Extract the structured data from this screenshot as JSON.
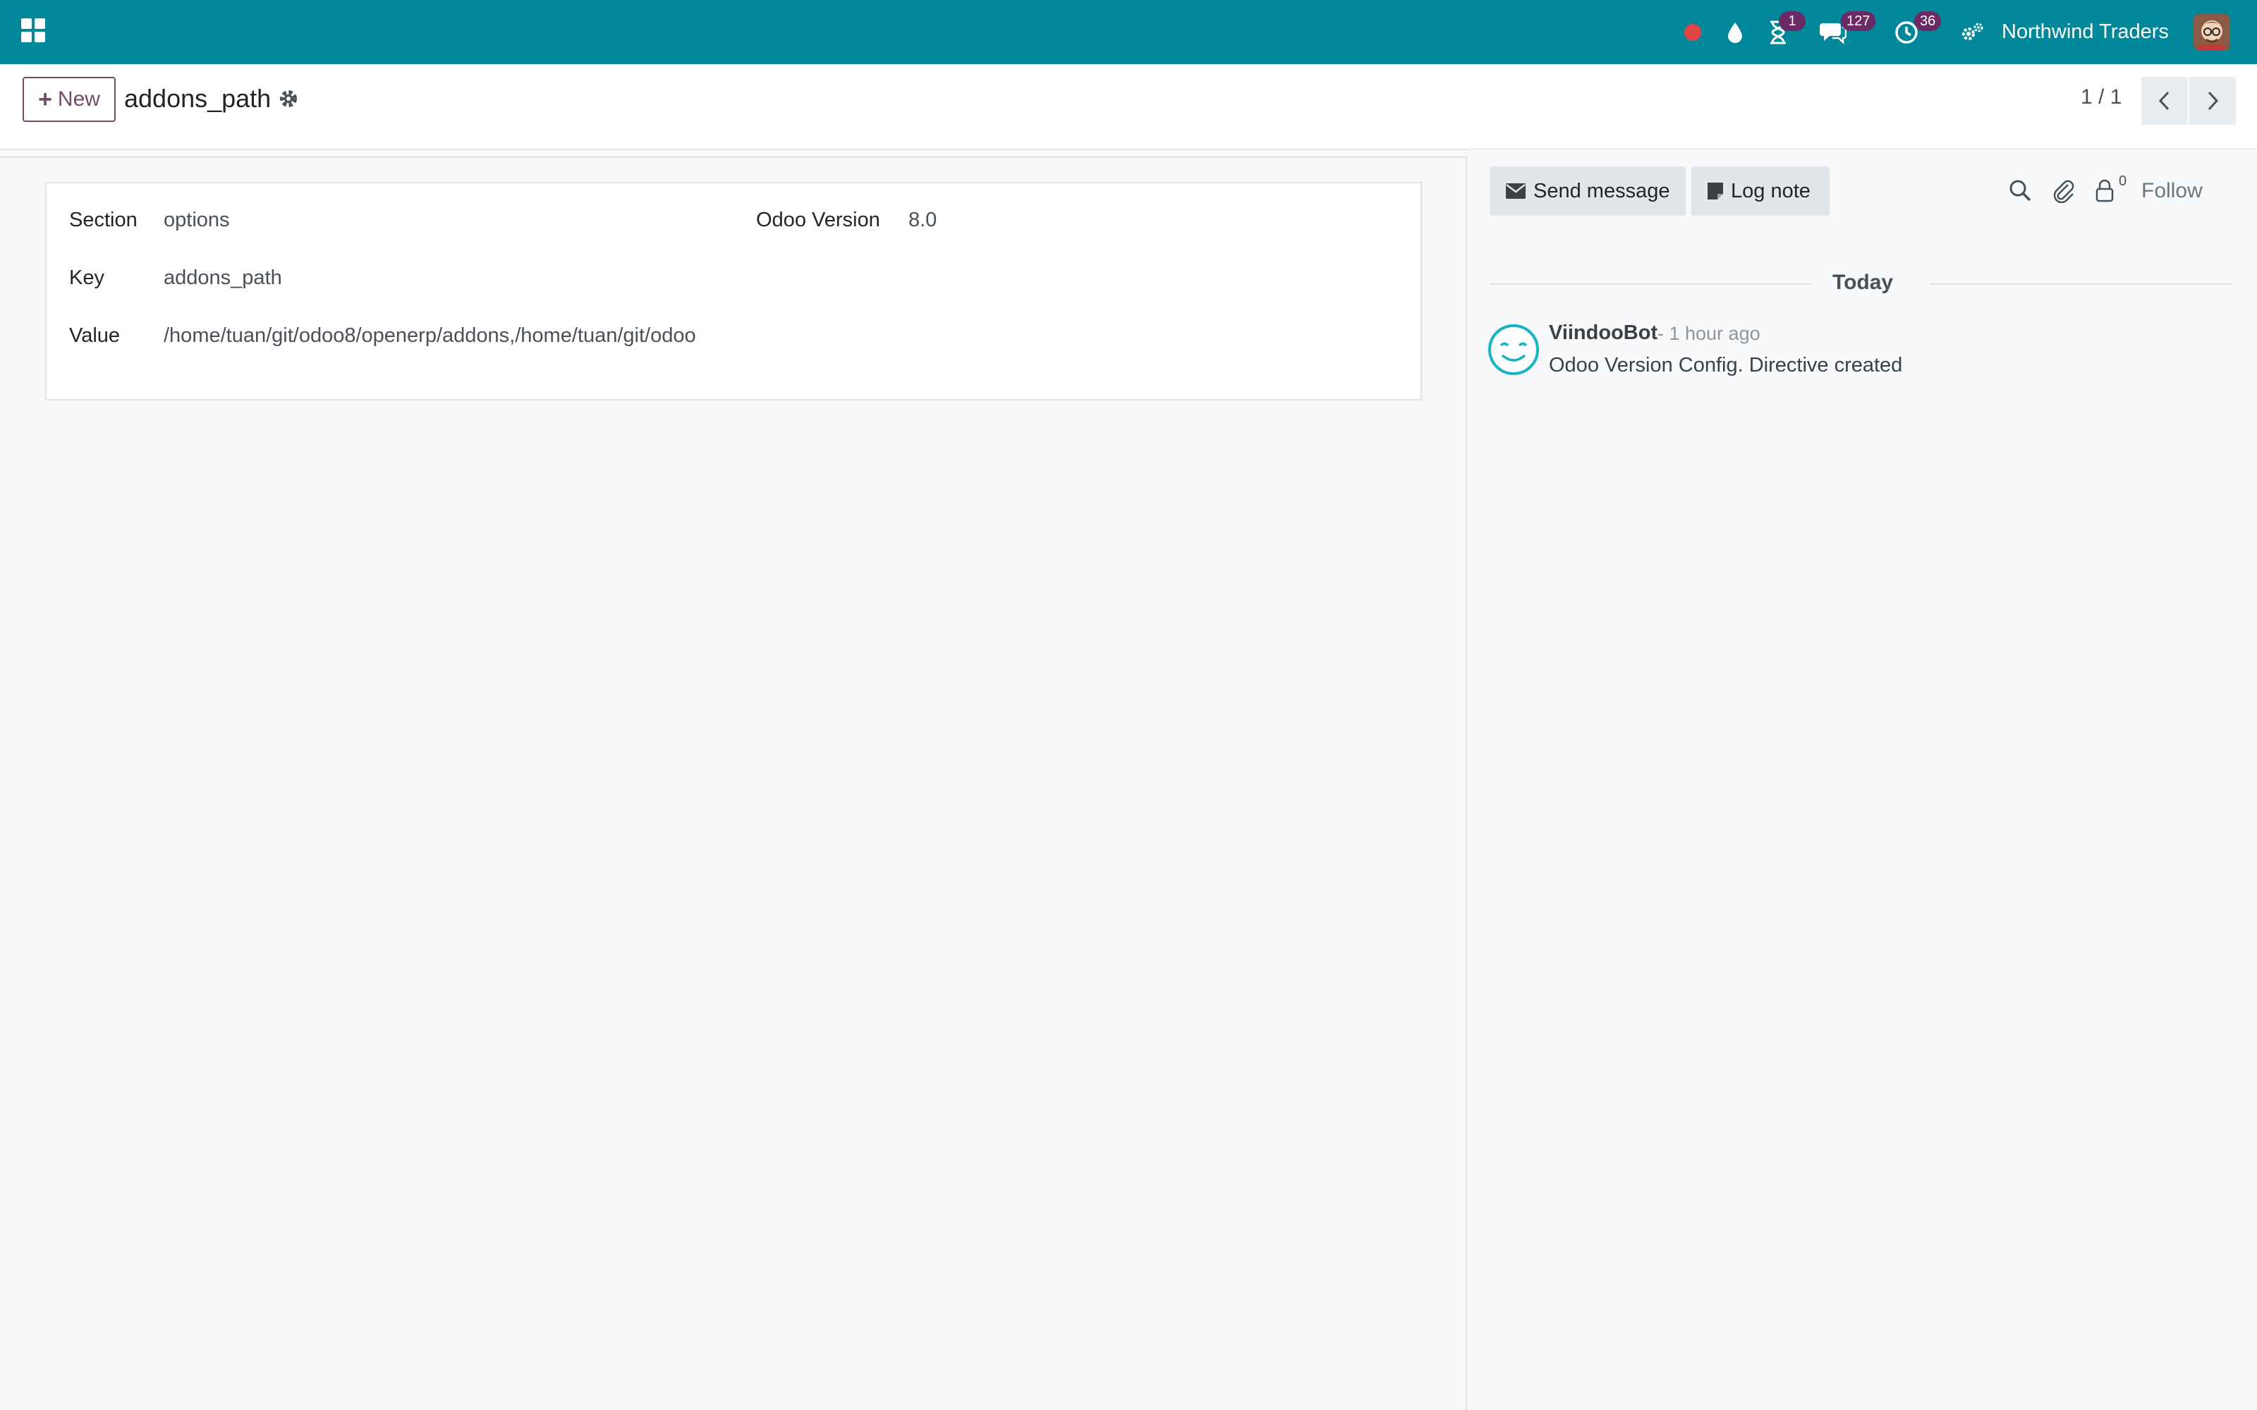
{
  "navbar": {
    "company": "Northwind Traders",
    "activity_badge": "1",
    "messages_badge": "127",
    "timesheet_badge": "36",
    "icons": [
      "apps-grid-icon",
      "status-dot-icon",
      "drop-icon",
      "hourglass-icon",
      "chat-icon",
      "clock-icon",
      "settings-icon"
    ],
    "status_color": "#e04545",
    "brand_color": "#00889a"
  },
  "control": {
    "new_label": "New",
    "title": "addons_path",
    "pager": "1 / 1"
  },
  "form": {
    "section_label": "Section",
    "section_value": "options",
    "key_label": "Key",
    "key_value": "addons_path",
    "value_label": "Value",
    "value_value": "/home/tuan/git/odoo8/openerp/addons,/home/tuan/git/odoo",
    "version_label": "Odoo Version",
    "version_value": "8.0"
  },
  "chatter": {
    "send_message": "Send message",
    "log_note": "Log note",
    "follower_count": "0",
    "follow": "Follow",
    "date_separator": "Today",
    "messages": [
      {
        "author": "ViindooBot",
        "time": "- 1 hour ago",
        "body": "Odoo Version Config. Directive created"
      }
    ]
  }
}
